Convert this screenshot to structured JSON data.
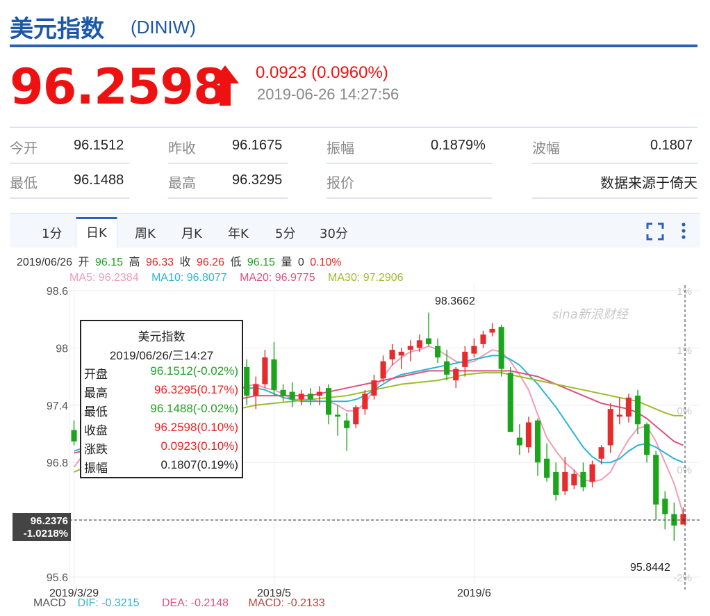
{
  "header": {
    "title": "美元指数",
    "symbol": "(DINIW)",
    "price": "96.2598",
    "change": "0.0923 (0.0960%)",
    "datetime": "2019-06-26 14:27:56",
    "price_color": "#ee1111",
    "brand_color": "#1c58a8"
  },
  "stats": {
    "open_label": "今开",
    "open_value": "96.1512",
    "prev_close_label": "昨收",
    "prev_close_value": "96.1675",
    "amplitude_label": "振幅",
    "amplitude_value": "0.1879%",
    "wave_label": "波幅",
    "wave_value": "0.1807",
    "low_label": "最低",
    "low_value": "96.1488",
    "high_label": "最高",
    "high_value": "96.3295",
    "quote_label": "报价",
    "source_text": "数据来源于倚天"
  },
  "tabs": [
    "1分",
    "日K",
    "周K",
    "月K",
    "年K",
    "5分",
    "30分"
  ],
  "active_tab": "日K",
  "toolbar_icons": [
    "fullscreen-icon",
    "more-vertical-icon"
  ],
  "ohlc_line": {
    "date": "2019/06/26",
    "open_label": "开",
    "open": "96.15",
    "high_label": "高",
    "high": "96.33",
    "close_label": "收",
    "close": "96.26",
    "low_label": "低",
    "low": "96.15",
    "volume_label": "量",
    "volume": "0",
    "pct": "0.10%"
  },
  "ma_legend": [
    {
      "text": "MA5: 96.2384",
      "color": "#f29bb8"
    },
    {
      "text": "MA10: 96.8077",
      "color": "#2cb4d6"
    },
    {
      "text": "MA20: 96.9775",
      "color": "#e0507a"
    },
    {
      "text": "MA30: 97.2906",
      "color": "#9bbc2a"
    }
  ],
  "tooltip": {
    "title": "美元指数",
    "date": "2019/06/26/三14:27",
    "rows": [
      {
        "label": "开盘",
        "value": "96.1512(-0.02%)",
        "color": "#22a022"
      },
      {
        "label": "最高",
        "value": "96.3295(0.17%)",
        "color": "#ee2222"
      },
      {
        "label": "最低",
        "value": "96.1488(-0.02%)",
        "color": "#22a022"
      },
      {
        "label": "收盘",
        "value": "96.2598(0.10%)",
        "color": "#ee2222"
      },
      {
        "label": "涨跌",
        "value": "0.0923(0.10%)",
        "color": "#ee2222"
      },
      {
        "label": "振幅",
        "value": "0.1807(0.19%)",
        "color": "#222222"
      }
    ]
  },
  "crosshair": {
    "value": "96.2376",
    "pct": "-1.0218%"
  },
  "annotations": {
    "max_label": "98.3662",
    "min_label": "95.8442"
  },
  "watermark": "sina新浪财经",
  "macd": {
    "label": "MACD",
    "dif": "DIF: -0.3215",
    "dea": "DEA: -0.2148",
    "macd": "MACD: -0.2133"
  },
  "chart_data": {
    "type": "candlestick",
    "title": "",
    "y_ticks": [
      "98.6",
      "98",
      "97.4",
      "96.8",
      "95.6"
    ],
    "right_ticks": [
      "1%",
      "1%",
      "0%",
      "0%",
      "-2%"
    ],
    "ylim": [
      95.6,
      98.6
    ],
    "x_labels": [
      "2019/3/29",
      "2019/5",
      "2019/6"
    ],
    "candles": [
      {
        "o": 97.14,
        "h": 97.24,
        "l": 96.98,
        "c": 97.02
      },
      {
        "o": 96.95,
        "h": 97.04,
        "l": 96.84,
        "c": 96.88
      },
      {
        "o": 96.96,
        "h": 97.06,
        "l": 96.82,
        "c": 97.0
      },
      {
        "o": 96.98,
        "h": 97.1,
        "l": 96.9,
        "c": 97.02
      },
      {
        "o": 97.06,
        "h": 97.22,
        "l": 97.0,
        "c": 97.2
      },
      {
        "o": 97.3,
        "h": 97.44,
        "l": 97.12,
        "c": 97.18
      },
      {
        "o": 97.14,
        "h": 97.36,
        "l": 97.08,
        "c": 97.26
      },
      {
        "o": 97.3,
        "h": 97.34,
        "l": 97.02,
        "c": 97.1
      },
      {
        "o": 97.1,
        "h": 97.22,
        "l": 96.96,
        "c": 97.16
      },
      {
        "o": 97.18,
        "h": 97.4,
        "l": 97.12,
        "c": 97.34
      },
      {
        "o": 97.38,
        "h": 97.42,
        "l": 97.12,
        "c": 97.2
      },
      {
        "o": 97.24,
        "h": 97.4,
        "l": 97.1,
        "c": 97.34
      },
      {
        "o": 97.4,
        "h": 97.6,
        "l": 97.34,
        "c": 97.54
      },
      {
        "o": 97.7,
        "h": 97.92,
        "l": 97.6,
        "c": 97.82
      },
      {
        "o": 97.86,
        "h": 98.16,
        "l": 97.82,
        "c": 98.06
      },
      {
        "o": 98.02,
        "h": 98.28,
        "l": 97.9,
        "c": 98.12
      },
      {
        "o": 98.12,
        "h": 98.26,
        "l": 97.84,
        "c": 97.96
      },
      {
        "o": 98.06,
        "h": 98.22,
        "l": 98.0,
        "c": 98.16
      },
      {
        "o": 98.0,
        "h": 98.08,
        "l": 97.7,
        "c": 97.78
      },
      {
        "o": 97.8,
        "h": 97.88,
        "l": 97.4,
        "c": 97.5
      },
      {
        "o": 97.5,
        "h": 97.7,
        "l": 97.36,
        "c": 97.62
      },
      {
        "o": 97.62,
        "h": 97.98,
        "l": 97.58,
        "c": 97.9
      },
      {
        "o": 97.88,
        "h": 98.06,
        "l": 97.5,
        "c": 97.56
      },
      {
        "o": 97.56,
        "h": 97.62,
        "l": 97.44,
        "c": 97.5
      },
      {
        "o": 97.54,
        "h": 97.64,
        "l": 97.38,
        "c": 97.46
      },
      {
        "o": 97.46,
        "h": 97.56,
        "l": 97.4,
        "c": 97.52
      },
      {
        "o": 97.52,
        "h": 97.58,
        "l": 97.4,
        "c": 97.46
      },
      {
        "o": 97.5,
        "h": 97.6,
        "l": 97.4,
        "c": 97.54
      },
      {
        "o": 97.58,
        "h": 97.62,
        "l": 97.2,
        "c": 97.3
      },
      {
        "o": 97.3,
        "h": 97.4,
        "l": 97.08,
        "c": 97.28
      },
      {
        "o": 97.24,
        "h": 97.32,
        "l": 96.92,
        "c": 97.16
      },
      {
        "o": 97.2,
        "h": 97.4,
        "l": 97.16,
        "c": 97.38
      },
      {
        "o": 97.36,
        "h": 97.56,
        "l": 97.3,
        "c": 97.52
      },
      {
        "o": 97.5,
        "h": 97.72,
        "l": 97.46,
        "c": 97.66
      },
      {
        "o": 97.68,
        "h": 97.92,
        "l": 97.64,
        "c": 97.86
      },
      {
        "o": 97.88,
        "h": 98.04,
        "l": 97.82,
        "c": 97.98
      },
      {
        "o": 97.92,
        "h": 98.0,
        "l": 97.78,
        "c": 97.96
      },
      {
        "o": 97.98,
        "h": 98.08,
        "l": 97.86,
        "c": 98.02
      },
      {
        "o": 98.0,
        "h": 98.14,
        "l": 97.96,
        "c": 98.08
      },
      {
        "o": 98.1,
        "h": 98.37,
        "l": 98.02,
        "c": 98.04
      },
      {
        "o": 98.02,
        "h": 98.1,
        "l": 97.84,
        "c": 97.9
      },
      {
        "o": 97.86,
        "h": 97.98,
        "l": 97.66,
        "c": 97.72
      },
      {
        "o": 97.66,
        "h": 97.8,
        "l": 97.58,
        "c": 97.78
      },
      {
        "o": 97.8,
        "h": 98.02,
        "l": 97.7,
        "c": 97.96
      },
      {
        "o": 97.94,
        "h": 98.1,
        "l": 97.9,
        "c": 98.02
      },
      {
        "o": 98.04,
        "h": 98.18,
        "l": 98.0,
        "c": 98.14
      },
      {
        "o": 98.16,
        "h": 98.26,
        "l": 98.12,
        "c": 98.2
      },
      {
        "o": 98.22,
        "h": 98.24,
        "l": 97.7,
        "c": 97.78
      },
      {
        "o": 97.74,
        "h": 97.8,
        "l": 97.3,
        "c": 97.12
      },
      {
        "o": 97.06,
        "h": 97.2,
        "l": 96.88,
        "c": 96.98
      },
      {
        "o": 96.96,
        "h": 97.28,
        "l": 96.9,
        "c": 97.22
      },
      {
        "o": 97.24,
        "h": 97.26,
        "l": 96.66,
        "c": 96.8
      },
      {
        "o": 96.84,
        "h": 97.0,
        "l": 96.6,
        "c": 96.64
      },
      {
        "o": 96.7,
        "h": 96.8,
        "l": 96.4,
        "c": 96.46
      },
      {
        "o": 96.5,
        "h": 96.86,
        "l": 96.46,
        "c": 96.7
      },
      {
        "o": 96.56,
        "h": 96.72,
        "l": 96.52,
        "c": 96.68
      },
      {
        "o": 96.7,
        "h": 96.8,
        "l": 96.5,
        "c": 96.54
      },
      {
        "o": 96.6,
        "h": 96.82,
        "l": 96.54,
        "c": 96.78
      },
      {
        "o": 96.84,
        "h": 96.98,
        "l": 96.78,
        "c": 96.96
      },
      {
        "o": 96.98,
        "h": 97.42,
        "l": 96.9,
        "c": 97.36
      },
      {
        "o": 97.28,
        "h": 97.48,
        "l": 97.2,
        "c": 97.3
      },
      {
        "o": 97.28,
        "h": 97.52,
        "l": 97.22,
        "c": 97.48
      },
      {
        "o": 97.5,
        "h": 97.56,
        "l": 97.1,
        "c": 97.2
      },
      {
        "o": 97.2,
        "h": 97.22,
        "l": 96.8,
        "c": 96.88
      },
      {
        "o": 96.88,
        "h": 96.92,
        "l": 96.2,
        "c": 96.36
      },
      {
        "o": 96.42,
        "h": 96.5,
        "l": 96.1,
        "c": 96.26
      },
      {
        "o": 96.26,
        "h": 96.38,
        "l": 95.98,
        "c": 96.14
      },
      {
        "o": 96.15,
        "h": 96.33,
        "l": 96.15,
        "c": 96.26
      }
    ],
    "ma": {
      "MA5": [
        96.75,
        96.88,
        96.96,
        97.02,
        97.06,
        97.1,
        97.2,
        97.32,
        97.5,
        97.7,
        97.82,
        97.9,
        98.0,
        97.96,
        97.88,
        97.84,
        97.78,
        97.62,
        97.58,
        97.6,
        97.62,
        97.58,
        97.56,
        97.52,
        97.46,
        97.46,
        97.46,
        97.44,
        97.44,
        97.4,
        97.34,
        97.34,
        97.42,
        97.56,
        97.7,
        97.82,
        97.9,
        97.96,
        97.98,
        98.02,
        97.98,
        97.92,
        97.86,
        97.84,
        97.86,
        97.92,
        97.98,
        97.96,
        97.86,
        97.72,
        97.56,
        97.3,
        97.06,
        96.92,
        96.8,
        96.72,
        96.62,
        96.6,
        96.62,
        96.7,
        96.88,
        97.04,
        97.16,
        97.18,
        97.02,
        96.8,
        96.58,
        96.26
      ],
      "MA10": [
        96.92,
        96.95,
        96.98,
        97.0,
        97.04,
        97.08,
        97.14,
        97.2,
        97.28,
        97.38,
        97.46,
        97.52,
        97.58,
        97.62,
        97.64,
        97.64,
        97.62,
        97.6,
        97.58,
        97.58,
        97.58,
        97.56,
        97.52,
        97.48,
        97.46,
        97.44,
        97.44,
        97.44,
        97.44,
        97.44,
        97.44,
        97.46,
        97.5,
        97.56,
        97.62,
        97.68,
        97.72,
        97.74,
        97.76,
        97.78,
        97.8,
        97.82,
        97.84,
        97.86,
        97.88,
        97.9,
        97.92,
        97.92,
        97.88,
        97.82,
        97.72,
        97.62,
        97.5,
        97.38,
        97.24,
        97.1,
        96.96,
        96.86,
        96.8,
        96.8,
        96.84,
        96.92,
        96.98,
        97.0,
        96.96,
        96.9,
        96.84,
        96.8
      ],
      "MA20": [
        96.9,
        96.92,
        96.94,
        96.96,
        96.98,
        97.0,
        97.02,
        97.06,
        97.1,
        97.14,
        97.18,
        97.22,
        97.26,
        97.3,
        97.34,
        97.38,
        97.42,
        97.44,
        97.46,
        97.48,
        97.5,
        97.5,
        97.5,
        97.5,
        97.5,
        97.5,
        97.5,
        97.52,
        97.54,
        97.56,
        97.58,
        97.6,
        97.62,
        97.64,
        97.66,
        97.68,
        97.7,
        97.72,
        97.74,
        97.76,
        97.76,
        97.76,
        97.76,
        97.76,
        97.76,
        97.76,
        97.76,
        97.76,
        97.76,
        97.74,
        97.72,
        97.7,
        97.66,
        97.62,
        97.58,
        97.54,
        97.5,
        97.46,
        97.42,
        97.4,
        97.38,
        97.36,
        97.32,
        97.26,
        97.18,
        97.1,
        97.02,
        96.98
      ],
      "MA30": [
        96.7,
        96.74,
        96.78,
        96.82,
        96.86,
        96.9,
        96.94,
        96.98,
        97.02,
        97.06,
        97.1,
        97.14,
        97.18,
        97.22,
        97.26,
        97.3,
        97.32,
        97.34,
        97.36,
        97.38,
        97.4,
        97.41,
        97.42,
        97.43,
        97.44,
        97.45,
        97.46,
        97.47,
        97.48,
        97.49,
        97.5,
        97.52,
        97.54,
        97.56,
        97.58,
        97.6,
        97.62,
        97.63,
        97.64,
        97.65,
        97.66,
        97.68,
        97.7,
        97.72,
        97.73,
        97.74,
        97.74,
        97.74,
        97.72,
        97.7,
        97.68,
        97.66,
        97.64,
        97.62,
        97.6,
        97.58,
        97.56,
        97.54,
        97.52,
        97.5,
        97.48,
        97.46,
        97.44,
        97.4,
        97.36,
        97.32,
        97.29,
        97.29
      ]
    }
  }
}
